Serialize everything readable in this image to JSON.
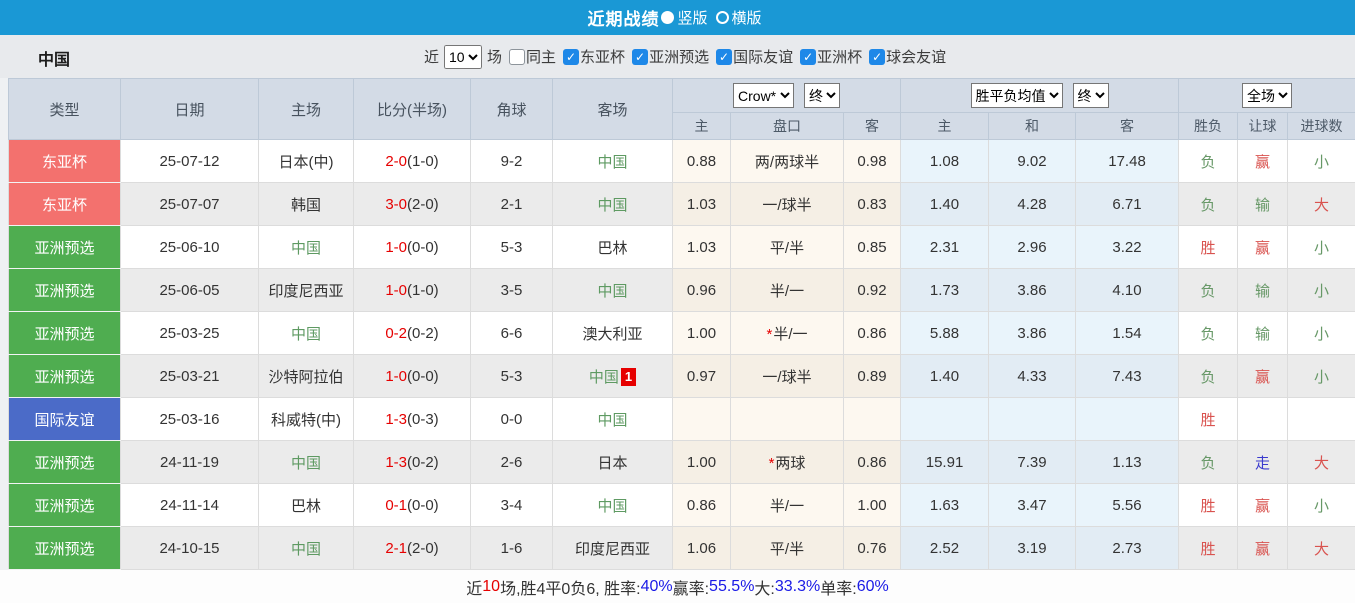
{
  "colors": {
    "topbar_blue": "#1a98d5",
    "checkbox_blue": "#1e88e8",
    "badge_salmon": "#f3716e",
    "badge_green": "#4fad50",
    "badge_blue": "#4b6bc8",
    "china_green": "#5e9a62",
    "score_red": "#e60000",
    "result_red": "#d9534f",
    "result_green": "#679867",
    "result_blue": "#3a3ace",
    "summary_blue": "#1a1ae6"
  },
  "icons": {
    "check": "✓"
  },
  "titlebar": {
    "title": "近期战绩",
    "radio_vertical": "竖版",
    "radio_horizontal": "横版",
    "selected": "竖版"
  },
  "filter": {
    "team": "中国",
    "near_label": "近",
    "count_value": "10",
    "games_label": "场",
    "checkboxes": [
      {
        "label": "同主",
        "checked": false
      },
      {
        "label": "东亚杯",
        "checked": true
      },
      {
        "label": "亚洲预选",
        "checked": true
      },
      {
        "label": "国际友谊",
        "checked": true
      },
      {
        "label": "亚洲杯",
        "checked": true
      },
      {
        "label": "球会友谊",
        "checked": true
      }
    ]
  },
  "table": {
    "selects": {
      "company": "Crow*",
      "company_time": "终",
      "europe": "胜平负均值",
      "europe_time": "终",
      "scope": "全场"
    },
    "columns": [
      "类型",
      "日期",
      "主场",
      "比分(半场)",
      "角球",
      "客场"
    ],
    "subcolumns": [
      "主",
      "盘口",
      "客",
      "主",
      "和",
      "客",
      "胜负",
      "让球",
      "进球数"
    ],
    "rows": [
      {
        "type": "东亚杯",
        "type_color": "salmon",
        "date": "25-07-12",
        "home": "日本(中)",
        "home_china": false,
        "score": "2-0",
        "half": "(1-0)",
        "corners": "9-2",
        "away": "中国",
        "away_china": true,
        "away_badge": "",
        "ah_home": "0.88",
        "ah_star": "",
        "ah_line": "两/两球半",
        "ah_away": "0.98",
        "eu_home": "1.08",
        "eu_draw": "9.02",
        "eu_away": "17.48",
        "wl": "负",
        "wl_c": "green",
        "ah_res": "赢",
        "ah_res_c": "red",
        "ou": "小",
        "ou_c": "green"
      },
      {
        "type": "东亚杯",
        "type_color": "salmon",
        "date": "25-07-07",
        "home": "韩国",
        "home_china": false,
        "score": "3-0",
        "half": "(2-0)",
        "corners": "2-1",
        "away": "中国",
        "away_china": true,
        "away_badge": "",
        "ah_home": "1.03",
        "ah_star": "",
        "ah_line": "一/球半",
        "ah_away": "0.83",
        "eu_home": "1.40",
        "eu_draw": "4.28",
        "eu_away": "6.71",
        "wl": "负",
        "wl_c": "green",
        "ah_res": "输",
        "ah_res_c": "green",
        "ou": "大",
        "ou_c": "red"
      },
      {
        "type": "亚洲预选",
        "type_color": "green",
        "date": "25-06-10",
        "home": "中国",
        "home_china": true,
        "score": "1-0",
        "half": "(0-0)",
        "corners": "5-3",
        "away": "巴林",
        "away_china": false,
        "away_badge": "",
        "ah_home": "1.03",
        "ah_star": "",
        "ah_line": "平/半",
        "ah_away": "0.85",
        "eu_home": "2.31",
        "eu_draw": "2.96",
        "eu_away": "3.22",
        "wl": "胜",
        "wl_c": "red",
        "ah_res": "赢",
        "ah_res_c": "red",
        "ou": "小",
        "ou_c": "green"
      },
      {
        "type": "亚洲预选",
        "type_color": "green",
        "date": "25-06-05",
        "home": "印度尼西亚",
        "home_china": false,
        "score": "1-0",
        "half": "(1-0)",
        "corners": "3-5",
        "away": "中国",
        "away_china": true,
        "away_badge": "",
        "ah_home": "0.96",
        "ah_star": "",
        "ah_line": "半/一",
        "ah_away": "0.92",
        "eu_home": "1.73",
        "eu_draw": "3.86",
        "eu_away": "4.10",
        "wl": "负",
        "wl_c": "green",
        "ah_res": "输",
        "ah_res_c": "green",
        "ou": "小",
        "ou_c": "green"
      },
      {
        "type": "亚洲预选",
        "type_color": "green",
        "date": "25-03-25",
        "home": "中国",
        "home_china": true,
        "score": "0-2",
        "half": "(0-2)",
        "corners": "6-6",
        "away": "澳大利亚",
        "away_china": false,
        "away_badge": "",
        "ah_home": "1.00",
        "ah_star": "*",
        "ah_line": "半/一",
        "ah_away": "0.86",
        "eu_home": "5.88",
        "eu_draw": "3.86",
        "eu_away": "1.54",
        "wl": "负",
        "wl_c": "green",
        "ah_res": "输",
        "ah_res_c": "green",
        "ou": "小",
        "ou_c": "green"
      },
      {
        "type": "亚洲预选",
        "type_color": "green",
        "date": "25-03-21",
        "home": "沙特阿拉伯",
        "home_china": false,
        "score": "1-0",
        "half": "(0-0)",
        "corners": "5-3",
        "away": "中国",
        "away_china": true,
        "away_badge": "1",
        "ah_home": "0.97",
        "ah_star": "",
        "ah_line": "一/球半",
        "ah_away": "0.89",
        "eu_home": "1.40",
        "eu_draw": "4.33",
        "eu_away": "7.43",
        "wl": "负",
        "wl_c": "green",
        "ah_res": "赢",
        "ah_res_c": "red",
        "ou": "小",
        "ou_c": "green"
      },
      {
        "type": "国际友谊",
        "type_color": "blue",
        "date": "25-03-16",
        "home": "科威特(中)",
        "home_china": false,
        "score": "1-3",
        "half": "(0-3)",
        "corners": "0-0",
        "away": "中国",
        "away_china": true,
        "away_badge": "",
        "ah_home": "",
        "ah_star": "",
        "ah_line": "",
        "ah_away": "",
        "eu_home": "",
        "eu_draw": "",
        "eu_away": "",
        "wl": "胜",
        "wl_c": "red",
        "ah_res": "",
        "ah_res_c": "",
        "ou": "",
        "ou_c": ""
      },
      {
        "type": "亚洲预选",
        "type_color": "green",
        "date": "24-11-19",
        "home": "中国",
        "home_china": true,
        "score": "1-3",
        "half": "(0-2)",
        "corners": "2-6",
        "away": "日本",
        "away_china": false,
        "away_badge": "",
        "ah_home": "1.00",
        "ah_star": "*",
        "ah_line": "两球",
        "ah_away": "0.86",
        "eu_home": "15.91",
        "eu_draw": "7.39",
        "eu_away": "1.13",
        "wl": "负",
        "wl_c": "green",
        "ah_res": "走",
        "ah_res_c": "blue",
        "ou": "大",
        "ou_c": "red"
      },
      {
        "type": "亚洲预选",
        "type_color": "green",
        "date": "24-11-14",
        "home": "巴林",
        "home_china": false,
        "score": "0-1",
        "half": "(0-0)",
        "corners": "3-4",
        "away": "中国",
        "away_china": true,
        "away_badge": "",
        "ah_home": "0.86",
        "ah_star": "",
        "ah_line": "半/一",
        "ah_away": "1.00",
        "eu_home": "1.63",
        "eu_draw": "3.47",
        "eu_away": "5.56",
        "wl": "胜",
        "wl_c": "red",
        "ah_res": "赢",
        "ah_res_c": "red",
        "ou": "小",
        "ou_c": "green"
      },
      {
        "type": "亚洲预选",
        "type_color": "green",
        "date": "24-10-15",
        "home": "中国",
        "home_china": true,
        "score": "2-1",
        "half": "(2-0)",
        "corners": "1-6",
        "away": "印度尼西亚",
        "away_china": false,
        "away_badge": "",
        "ah_home": "1.06",
        "ah_star": "",
        "ah_line": "平/半",
        "ah_away": "0.76",
        "eu_home": "2.52",
        "eu_draw": "3.19",
        "eu_away": "2.73",
        "wl": "胜",
        "wl_c": "red",
        "ah_res": "赢",
        "ah_res_c": "red",
        "ou": "大",
        "ou_c": "red"
      }
    ]
  },
  "summary": {
    "segments": [
      {
        "text": "近",
        "color": "default"
      },
      {
        "text": "10",
        "color": "red"
      },
      {
        "text": "场,胜4平0负6, 胜率:",
        "color": "default"
      },
      {
        "text": "40%",
        "color": "blue"
      },
      {
        "text": " 赢率:",
        "color": "default"
      },
      {
        "text": "55.5%",
        "color": "blue"
      },
      {
        "text": " 大:",
        "color": "default"
      },
      {
        "text": "33.3%",
        "color": "blue"
      },
      {
        "text": " 单率:",
        "color": "default"
      },
      {
        "text": "60%",
        "color": "blue"
      }
    ]
  }
}
